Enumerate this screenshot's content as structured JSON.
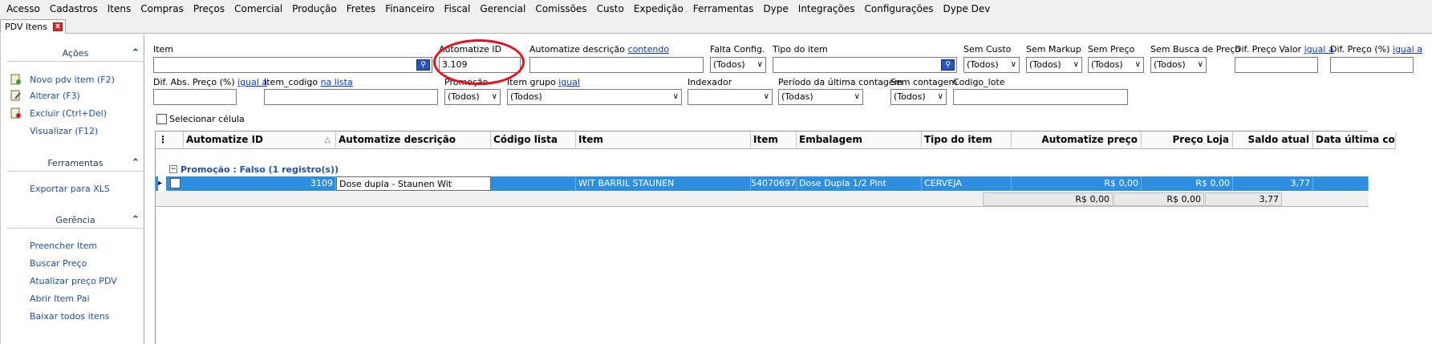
{
  "menu": [
    "Acesso",
    "Cadastros",
    "Itens",
    "Compras",
    "Preços",
    "Comercial",
    "Produção",
    "Fretes",
    "Financeiro",
    "Fiscal",
    "Gerencial",
    "Comissões",
    "Custo",
    "Expedição",
    "Ferramentas",
    "Dype",
    "Integrações",
    "Configurações",
    "Dype Dev"
  ],
  "tab": {
    "label": "PDV Itens",
    "close": "x"
  },
  "sidebar": {
    "acoes": {
      "title": "Ações",
      "items": [
        "Novo pdv item (F2)",
        "Alterar (F3)",
        "Excluir (Ctrl+Del)",
        "Visualizar (F12)"
      ]
    },
    "ferramentas": {
      "title": "Ferramentas",
      "items": [
        "Exportar para XLS"
      ]
    },
    "gerencia": {
      "title": "Gerência",
      "items": [
        "Preencher Item",
        "Buscar Preço",
        "Atualizar preço PDV",
        "Abrir Item Pai",
        "Baixar todos itens"
      ]
    }
  },
  "filters": {
    "item": {
      "label": "Item",
      "value": ""
    },
    "automatize_id": {
      "label": "Automatize ID",
      "value": "3.109"
    },
    "automatize_desc": {
      "label": "Automatize descrição",
      "mode": "contendo",
      "value": ""
    },
    "falta_config": {
      "label": "Falta Config.",
      "value": "(Todos)"
    },
    "tipo_item": {
      "label": "Tipo do item",
      "value": ""
    },
    "sem_custo": {
      "label": "Sem Custo",
      "value": "(Todos)"
    },
    "sem_markup": {
      "label": "Sem Markup",
      "value": "(Todos)"
    },
    "sem_preco": {
      "label": "Sem Preço",
      "value": "(Todos)"
    },
    "sem_busca_preco": {
      "label": "Sem Busca de Preço",
      "value": "(Todos)"
    },
    "dif_preco_valor": {
      "label": "Dif. Preço Valor",
      "mode": "igual a",
      "value": ""
    },
    "dif_preco_pct": {
      "label": "Dif. Preço (%)",
      "mode": "igual a",
      "value": ""
    },
    "dif_abs_preco": {
      "label": "Dif. Abs. Preço (%)",
      "mode": "igual a",
      "value": ""
    },
    "item_codigo": {
      "label": "Item_codigo",
      "mode": "na lista",
      "value": ""
    },
    "promocao": {
      "label": "Promoção",
      "value": "(Todos)"
    },
    "item_grupo": {
      "label": "Item grupo",
      "mode": "igual",
      "value": "(Todos)"
    },
    "indexador": {
      "label": "Indexador",
      "value": ""
    },
    "periodo_contagem": {
      "label": "Período da última contagem",
      "value": "(Todas)"
    },
    "sem_contagem": {
      "label": "Sem contagem",
      "value": "(Todos)"
    },
    "codigo_lote": {
      "label": "Codigo_lote",
      "value": ""
    }
  },
  "select_cell_label": "Selecionar célula",
  "grid": {
    "columns": [
      "Automatize ID",
      "Automatize descrição",
      "Código lista",
      "Item",
      "Item",
      "Embalagem",
      "Tipo do item",
      "Automatize preço",
      "Preço Loja",
      "Saldo atual",
      "Data última con"
    ],
    "group_toggle": "−",
    "group_label": "Promoção : Falso (1 registro(s))",
    "rows": [
      {
        "automatize_id": "3109",
        "automatize_desc": "Dose dupla - Staunen Wit",
        "codigo_lista": "",
        "item_nome": "WIT BARRIL STAUNEN",
        "item_codigo": "54070697",
        "embalagem": "Dose Dupla 1/2 Pint",
        "tipo_item": "CERVEJA",
        "automatize_preco": "R$ 0,00",
        "preco_loja": "R$ 0,00",
        "saldo_atual": "3,77",
        "data_ultima": ""
      }
    ],
    "totals": {
      "automatize_preco": "R$ 0,00",
      "preco_loja": "R$ 0,00",
      "saldo_atual": "3,77"
    }
  }
}
